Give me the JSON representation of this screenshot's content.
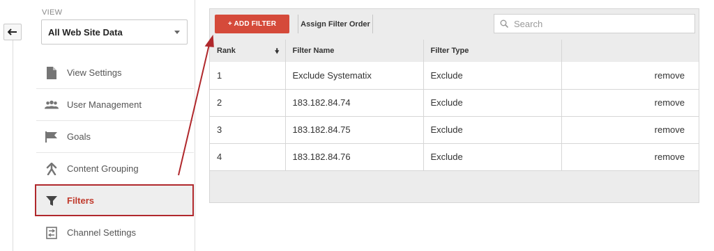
{
  "sidebar": {
    "view_label": "VIEW",
    "view_select": "All Web Site Data",
    "items": [
      {
        "label": "View Settings",
        "icon": "document-icon"
      },
      {
        "label": "User Management",
        "icon": "people-icon"
      },
      {
        "label": "Goals",
        "icon": "flag-icon"
      },
      {
        "label": "Content Grouping",
        "icon": "content-grouping-icon"
      },
      {
        "label": "Filters",
        "icon": "funnel-icon",
        "active": true
      },
      {
        "label": "Channel Settings",
        "icon": "channel-settings-icon"
      }
    ]
  },
  "toolbar": {
    "add_filter": "+ ADD FILTER",
    "assign_order": "Assign Filter Order",
    "search_placeholder": "Search"
  },
  "table": {
    "columns": [
      "Rank",
      "Filter Name",
      "Filter Type",
      ""
    ],
    "rows": [
      {
        "rank": "1",
        "name": "Exclude Systematix",
        "type": "Exclude",
        "action": "remove"
      },
      {
        "rank": "2",
        "name": "183.182.84.74",
        "type": "Exclude",
        "action": "remove"
      },
      {
        "rank": "3",
        "name": "183.182.84.75",
        "type": "Exclude",
        "action": "remove"
      },
      {
        "rank": "4",
        "name": "183.182.84.76",
        "type": "Exclude",
        "action": "remove"
      }
    ]
  },
  "colors": {
    "accent": "#d54a3a",
    "active_text": "#c0392b",
    "link": "#3b5ea8",
    "annotation": "#b0282c"
  }
}
